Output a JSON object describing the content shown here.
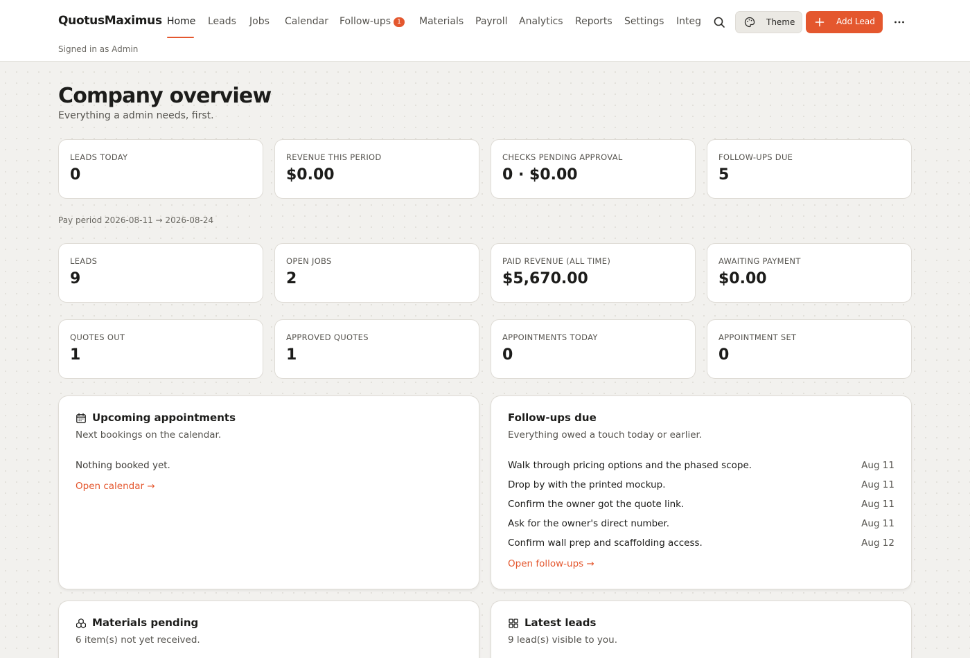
{
  "header": {
    "brand": "QuotusMaximus",
    "signed_in": "Signed in as Admin",
    "nav": [
      {
        "label": "Home",
        "active": true
      },
      {
        "label": "Leads"
      },
      {
        "label": "Jobs"
      },
      {
        "label": "Calendar"
      },
      {
        "label": "Follow-ups",
        "badge": "1"
      },
      {
        "label": "Materials"
      },
      {
        "label": "Payroll"
      },
      {
        "label": "Analytics"
      },
      {
        "label": "Reports"
      },
      {
        "label": "Settings"
      },
      {
        "label": "Integ"
      }
    ],
    "search_icon": "search-icon",
    "theme_label": "Theme",
    "theme_icon": "palette-icon",
    "add_label": "Add Lead",
    "add_icon": "plus-icon",
    "more_icon": "more-horizontal-icon"
  },
  "page": {
    "title": "Company overview",
    "subtitle": "Everything a admin needs, first.",
    "pay_period": "Pay period 2026-08-11 → 2026-08-24"
  },
  "stats_top": [
    {
      "label": "LEADS TODAY",
      "value": "0"
    },
    {
      "label": "REVENUE THIS PERIOD",
      "value": "$0.00"
    },
    {
      "label": "CHECKS PENDING APPROVAL",
      "value": "0 · $0.00"
    },
    {
      "label": "FOLLOW-UPS DUE",
      "value": "5"
    }
  ],
  "stats_mid": [
    {
      "label": "LEADS",
      "value": "9"
    },
    {
      "label": "OPEN JOBS",
      "value": "2"
    },
    {
      "label": "PAID REVENUE (ALL TIME)",
      "value": "$5,670.00"
    },
    {
      "label": "AWAITING PAYMENT",
      "value": "$0.00"
    }
  ],
  "stats_bottom": [
    {
      "label": "QUOTES OUT",
      "value": "1"
    },
    {
      "label": "APPROVED QUOTES",
      "value": "1"
    },
    {
      "label": "APPOINTMENTS TODAY",
      "value": "0"
    },
    {
      "label": "APPOINTMENT SET",
      "value": "0"
    }
  ],
  "appointments": {
    "title": "Upcoming appointments",
    "subtitle": "Next bookings on the calendar.",
    "empty": "Nothing booked yet.",
    "link": "Open calendar →",
    "icon": "calendar-icon"
  },
  "followups": {
    "title": "Follow-ups due",
    "subtitle": "Everything owed a touch today or earlier.",
    "items": [
      {
        "text": "Walk through pricing options and the phased scope.",
        "date": "Aug 11"
      },
      {
        "text": "Drop by with the printed mockup.",
        "date": "Aug 11"
      },
      {
        "text": "Confirm the owner got the quote link.",
        "date": "Aug 11"
      },
      {
        "text": "Ask for the owner's direct number.",
        "date": "Aug 11"
      },
      {
        "text": "Confirm wall prep and scaffolding access.",
        "date": "Aug 12"
      }
    ],
    "link": "Open follow-ups →"
  },
  "materials": {
    "title": "Materials pending",
    "subtitle": "6 item(s) not yet received.",
    "icon": "boxes-icon"
  },
  "latest_leads": {
    "title": "Latest leads",
    "subtitle": "9 lead(s) visible to you.",
    "icon": "grid-icon"
  },
  "colors": {
    "accent": "#e4572e",
    "background": "#f2f1ee",
    "card": "#ffffff",
    "border": "#dedbd5"
  }
}
